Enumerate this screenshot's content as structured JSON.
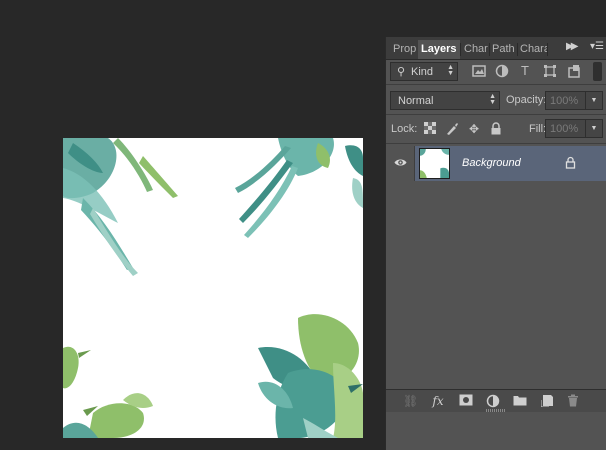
{
  "tabs": [
    {
      "label": "Prop",
      "active": false
    },
    {
      "label": "Layers",
      "active": true
    },
    {
      "label": "Char",
      "active": false
    },
    {
      "label": "Path",
      "active": false
    },
    {
      "label": "Chara",
      "active": false
    }
  ],
  "filter": {
    "kind_label": "Kind",
    "icons": [
      "pixel-layer-filter-icon",
      "adjustment-layer-filter-icon",
      "type-layer-filter-icon",
      "shape-layer-filter-icon",
      "smart-object-filter-icon"
    ]
  },
  "blend": {
    "mode": "Normal",
    "opacity_label": "Opacity:",
    "opacity_value": "100%",
    "fill_label": "Fill:",
    "fill_value": "100%"
  },
  "lock": {
    "label": "Lock:",
    "icons": [
      "lock-transparent-pixels-icon",
      "lock-image-pixels-icon",
      "lock-position-icon",
      "lock-all-icon"
    ]
  },
  "layers": [
    {
      "name": "Background",
      "visible": true,
      "locked": true
    }
  ],
  "bottom_icons": [
    "link-layers-icon",
    "layer-style-fx-icon",
    "add-mask-icon",
    "adjustment-layer-icon",
    "new-group-icon",
    "new-layer-icon",
    "delete-layer-icon"
  ],
  "colors": {
    "workspace": "#282828",
    "panel": "#535353",
    "selected_layer": "#5a6579",
    "bird_teal": "#3f8f86",
    "bird_green": "#8fbf6a"
  }
}
